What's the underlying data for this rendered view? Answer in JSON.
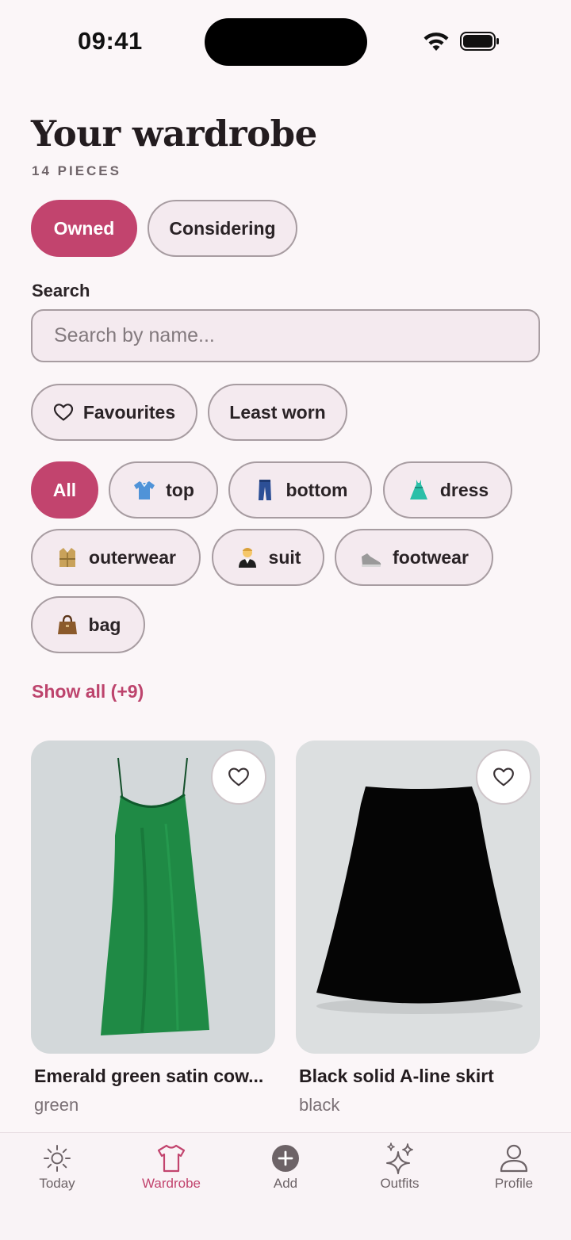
{
  "status_bar": {
    "time": "09:41"
  },
  "header": {
    "title": "Your wardrobe",
    "subtitle": "14 PIECES"
  },
  "segments": {
    "owned": "Owned",
    "considering": "Considering"
  },
  "search": {
    "label": "Search",
    "placeholder": "Search by name..."
  },
  "filters": {
    "favourites": "Favourites",
    "least_worn": "Least worn"
  },
  "categories": {
    "all": "All",
    "top": "top",
    "bottom": "bottom",
    "dress": "dress",
    "outerwear": "outerwear",
    "suit": "suit",
    "footwear": "footwear",
    "bag": "bag"
  },
  "show_all": "Show all (+9)",
  "items": [
    {
      "name": "Emerald green satin cow...",
      "color": "green",
      "swatch": "#1f8a45"
    },
    {
      "name": "Black solid A-line skirt",
      "color": "black",
      "swatch": "#000000"
    }
  ],
  "tabbar": {
    "today": "Today",
    "wardrobe": "Wardrobe",
    "add": "Add",
    "outfits": "Outfits",
    "profile": "Profile"
  },
  "colors": {
    "accent": "#c2446e",
    "background": "#fbf6f8",
    "pill_bg": "#f4eaef"
  }
}
